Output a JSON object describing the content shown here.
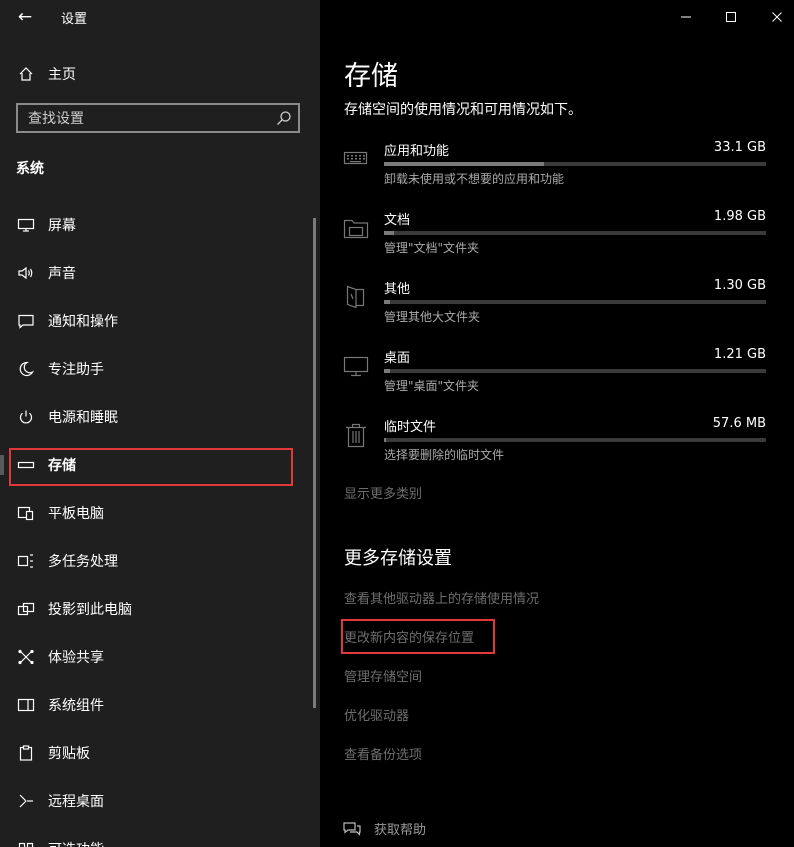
{
  "window": {
    "title": "设置",
    "back_icon": "←",
    "controls": [
      "minimize-icon",
      "maximize-icon",
      "close-icon"
    ]
  },
  "sidebar": {
    "home_label": "主页",
    "search_placeholder": "查找设置",
    "section_label": "系统",
    "items": [
      {
        "label": "屏幕",
        "icon": "monitor-icon"
      },
      {
        "label": "声音",
        "icon": "speaker-icon"
      },
      {
        "label": "通知和操作",
        "icon": "message-icon"
      },
      {
        "label": "专注助手",
        "icon": "moon-icon"
      },
      {
        "label": "电源和睡眠",
        "icon": "power-icon"
      },
      {
        "label": "存储",
        "icon": "storage-drive-icon",
        "selected": true
      },
      {
        "label": "平板电脑",
        "icon": "tablet-icon"
      },
      {
        "label": "多任务处理",
        "icon": "multitask-icon"
      },
      {
        "label": "投影到此电脑",
        "icon": "project-icon"
      },
      {
        "label": "体验共享",
        "icon": "shared-experience-icon"
      },
      {
        "label": "系统组件",
        "icon": "components-icon"
      },
      {
        "label": "剪贴板",
        "icon": "clipboard-icon"
      },
      {
        "label": "远程桌面",
        "icon": "remote-desktop-icon"
      },
      {
        "label": "可选功能",
        "icon": "optional-features-icon"
      }
    ]
  },
  "main": {
    "title": "存储",
    "description": "存储空间的使用情况和可用情况如下。",
    "categories": [
      {
        "name": "应用和功能",
        "size": "33.1 GB",
        "subtitle": "卸载未使用或不想要的应用和功能",
        "fraction": 0.42,
        "icon": "keyboard-icon"
      },
      {
        "name": "文档",
        "size": "1.98 GB",
        "subtitle": "管理\"文档\"文件夹",
        "fraction": 0.025,
        "icon": "folder-icon"
      },
      {
        "name": "其他",
        "size": "1.30 GB",
        "subtitle": "管理其他大文件夹",
        "fraction": 0.017,
        "icon": "other-file-icon"
      },
      {
        "name": "桌面",
        "size": "1.21 GB",
        "subtitle": "管理\"桌面\"文件夹",
        "fraction": 0.016,
        "icon": "desktop-monitor-icon"
      },
      {
        "name": "临时文件",
        "size": "57.6 MB",
        "subtitle": "选择要删除的临时文件",
        "fraction": 0.003,
        "icon": "trash-icon"
      }
    ],
    "show_more": "显示更多类别",
    "more_settings_title": "更多存储设置",
    "more_links": [
      "查看其他驱动器上的存储使用情况",
      "更改新内容的保存位置",
      "管理存储空间",
      "优化驱动器",
      "查看备份选项"
    ],
    "help_label": "获取帮助"
  },
  "colors": {
    "sidebar_bg": "#1f1f1f",
    "main_bg": "#000000",
    "highlight": "#e0383b",
    "bar_track": "#3a3a3a",
    "bar_fill": "#7a7a7a",
    "link_gray": "#6e6e6e"
  }
}
